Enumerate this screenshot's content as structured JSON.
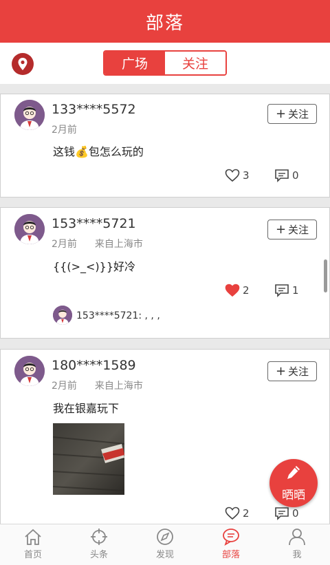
{
  "header": {
    "title": "部落"
  },
  "tabs": [
    {
      "label": "广场",
      "active": true
    },
    {
      "label": "关注",
      "active": false
    }
  ],
  "posts": [
    {
      "user": "133****5572",
      "time": "2月前",
      "location": "",
      "content": "这钱💰包怎么玩的",
      "follow_label": "关注",
      "likes": "3",
      "liked": false,
      "comments": "0"
    },
    {
      "user": "153****5721",
      "time": "2月前",
      "location": "来自上海市",
      "content": "{{(>_<)}}好冷",
      "follow_label": "关注",
      "likes": "2",
      "liked": true,
      "comments": "1",
      "reply": "153****5721: , , ,"
    },
    {
      "user": "180****1589",
      "time": "2月前",
      "location": "来自上海市",
      "content": "我在银嘉玩下",
      "follow_label": "关注",
      "likes": "2",
      "liked": false,
      "comments": "0"
    }
  ],
  "fab": {
    "label": "晒晒"
  },
  "nav": [
    {
      "label": "首页",
      "icon": "home-icon"
    },
    {
      "label": "头条",
      "icon": "crosshair-icon"
    },
    {
      "label": "发现",
      "icon": "compass-icon"
    },
    {
      "label": "部落",
      "icon": "chat-bubble-icon",
      "active": true
    },
    {
      "label": "我",
      "icon": "person-icon"
    }
  ],
  "colors": {
    "accent": "#e8413e",
    "liked": "#e8413e"
  }
}
